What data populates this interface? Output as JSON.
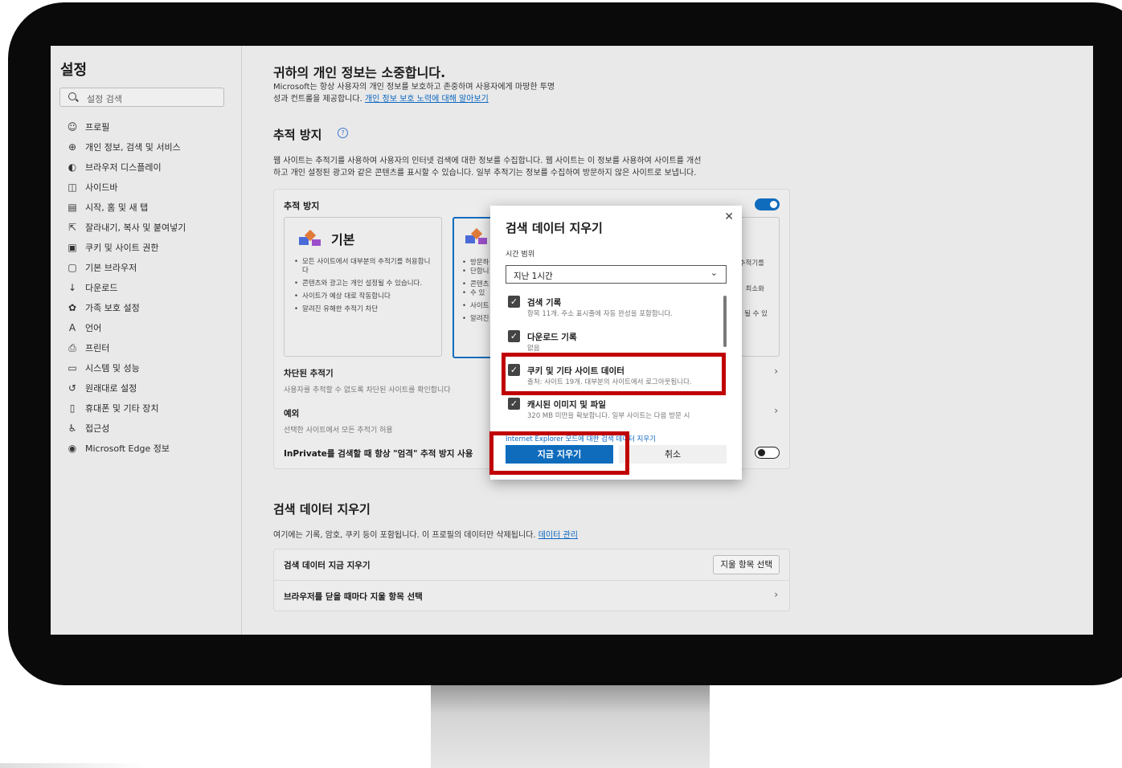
{
  "sidebar": {
    "title": "설정",
    "search_placeholder": "설정 검색",
    "items": [
      {
        "label": "프로필",
        "icon": "profile-icon"
      },
      {
        "label": "개인 정보, 검색 및 서비스",
        "icon": "lock-icon"
      },
      {
        "label": "브라우저 디스플레이",
        "icon": "display-icon"
      },
      {
        "label": "사이드바",
        "icon": "sidebar-icon"
      },
      {
        "label": "시작, 홈 및 새 탭",
        "icon": "home-tab-icon"
      },
      {
        "label": "잘라내기, 복사 및 붙여넣기",
        "icon": "share-icon"
      },
      {
        "label": "쿠키 및 사이트 권한",
        "icon": "cookie-icon"
      },
      {
        "label": "기본 브라우저",
        "icon": "browser-icon"
      },
      {
        "label": "다운로드",
        "icon": "download-icon"
      },
      {
        "label": "가족 보호 설정",
        "icon": "family-icon"
      },
      {
        "label": "언어",
        "icon": "language-icon"
      },
      {
        "label": "프린터",
        "icon": "printer-icon"
      },
      {
        "label": "시스템 및 성능",
        "icon": "system-icon"
      },
      {
        "label": "원래대로 설정",
        "icon": "reset-icon"
      },
      {
        "label": "휴대폰 및 기타 장치",
        "icon": "phone-icon"
      },
      {
        "label": "접근성",
        "icon": "accessibility-icon"
      },
      {
        "label": "Microsoft Edge 정보",
        "icon": "edge-icon"
      }
    ]
  },
  "privacy": {
    "title": "귀하의 개인 정보는 소중합니다.",
    "desc_line1": "Microsoft는 항상 사용자의 개인 정보를 보호하고 존중하며 사용자에게 마땅한 투명",
    "desc_line2": "성과 컨트롤을 제공합니다.",
    "learn_link": "개인 정보 보호 노력에 대해 알아보기"
  },
  "tracking": {
    "title": "추적 방지",
    "desc_line1": "웹 사이트는 추적기를 사용하여 사용자의 인터넷 검색에 대한 정보를 수집합니다. 웹 사이트는 이 정보를 사용하여 사이트를 개선",
    "desc_line2": "하고 개인 설정된 광고와 같은 콘텐츠를 표시할 수 있습니다. 일부 추적기는 정보를 수집하여 방문하지 않은 사이트로 보냅니다.",
    "card_label": "추적 방지",
    "toggle_on": true,
    "basic": {
      "title": "기본",
      "bullets": [
        "모든 사이트에서 대부분의 추적기를 허용합니다",
        "콘텐츠와 광고는 개인 설정될 수 있습니다.",
        "사이트가 예상 대로 작동합니다",
        "알려진 유해한 추적기 차단"
      ]
    },
    "balanced_fragments": [
      "방문하",
      "단합니",
      "콘텐츠",
      "수 있",
      "사이트",
      "알려진"
    ],
    "strict_fragments": [
      "추적기를",
      "최소화",
      "될 수 있"
    ],
    "blocked_title": "차단된 추적기",
    "blocked_sub": "사용자를 추적할 수 없도록 차단된 사이트를 확인합니다",
    "exceptions_title": "예외",
    "exceptions_sub": "선택한 사이트에서 모든 추적기 허용",
    "inprivate_label": "InPrivate를 검색할 때 항상 \"엄격\" 추적 방지 사용",
    "inprivate_on": false
  },
  "clear": {
    "title": "검색 데이터 지우기",
    "desc": "여기에는 기록, 암호, 쿠키 등이 포함됩니다. 이 프로필의 데이터만 삭제됩니다.",
    "manage_link": "데이터 관리",
    "now_label": "검색 데이터 지금 지우기",
    "choose_button": "지울 항목 선택",
    "on_close_label": "브라우저를 닫을 때마다 지울 항목 선택"
  },
  "dialog": {
    "title": "검색 데이터 지우기",
    "range_label": "시간 범위",
    "range_value": "지난 1시간",
    "items": [
      {
        "title": "검색 기록",
        "sub": "항목 11개. 주소 표시줄에 자동 완성을 포함합니다.",
        "checked": true
      },
      {
        "title": "다운로드 기록",
        "sub": "없음",
        "checked": true
      },
      {
        "title": "쿠키 및 기타 사이트 데이터",
        "sub": "출처: 사이트 19개. 대부분의 사이트에서 로그아웃됩니다.",
        "checked": true
      },
      {
        "title": "캐시된 이미지 및 파일",
        "sub": "320 MB 미만을 확보합니다. 일부 사이트는 다음 방문 시",
        "checked": true
      }
    ],
    "ie_link": "Internet Explorer 모드에 대한 검색 데이터 지우기",
    "clear_button": "지금 지우기",
    "cancel_button": "취소"
  },
  "colors": {
    "accent": "#0f6cbd",
    "highlight": "#c00000",
    "bezel": "#0a0a0a"
  }
}
